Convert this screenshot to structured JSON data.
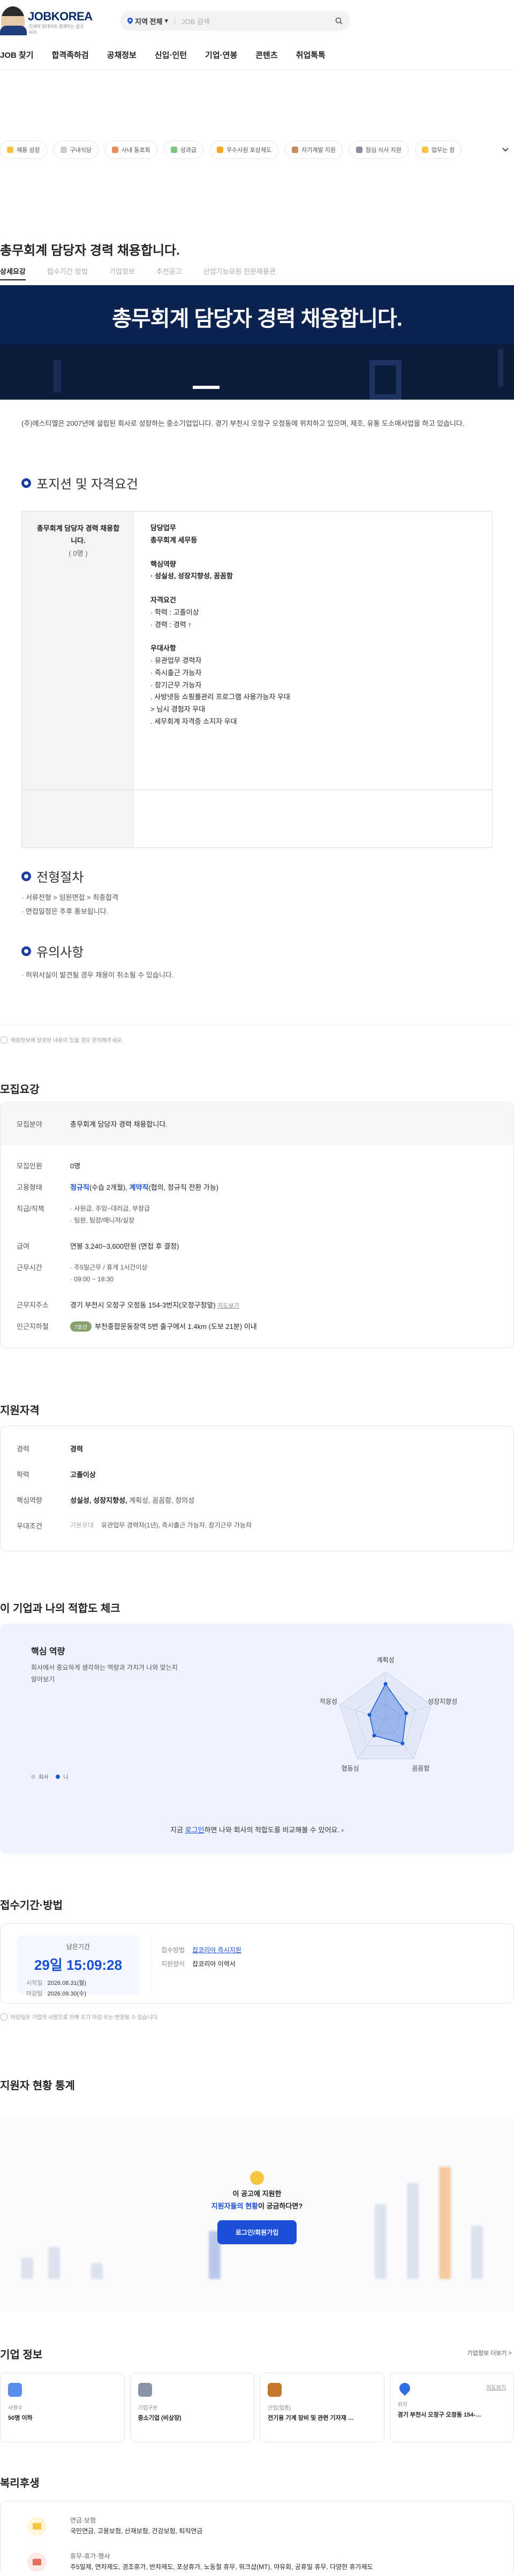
{
  "header": {
    "brand": "JOBKOREA",
    "slogan": "인생의 업데이트 함께하는 잡코리아",
    "region": "지역 전체",
    "search_placeholder": "JOB 검색",
    "nav": [
      "JOB 찾기",
      "합격족하검",
      "공채정보",
      "신입·인턴",
      "기업·연봉",
      "콘텐츠",
      "취업톡톡"
    ]
  },
  "quick_chips": [
    {
      "label": "채용 성장",
      "color": "#f5c542"
    },
    {
      "label": "구내식당",
      "color": "#c9cdd4"
    },
    {
      "label": "사내 동호회",
      "color": "#f08a5d"
    },
    {
      "label": "성과급",
      "color": "#7bc67b"
    },
    {
      "label": "우수사원 포상제도",
      "color": "#f5a623"
    },
    {
      "label": "자기계발 지원",
      "color": "#c98b5a"
    },
    {
      "label": "점심 식사 지원",
      "color": "#8a8f99"
    },
    {
      "label": "업무는 정",
      "color": "#f5c542"
    }
  ],
  "job_title": "총무회계 담당자 경력 채용합니다.",
  "tabs": [
    "상세요강",
    "접수기간·방법",
    "기업정보",
    "추천공고",
    "산업기능요원 전문채용관"
  ],
  "hero_title": "총무회계 담당자 경력 채용합니다.",
  "intro": "(주)에스티엘은 2007년에 설립된 회사로 성장하는 중소기업입니다. 경기 부천시 오정구 오정동에 위치하고 있으며, 제조, 유통 도소매사업을 하고 있습니다.",
  "position_section": {
    "heading": "포지션 및 자격요건",
    "role": "총무회계 담당자 경력 채용합니다.",
    "count": "( 0명 )",
    "duty_title": "담당업무",
    "duty": "총무회계 세무등",
    "core_title": "핵심역량",
    "core": "· 성실성, 성장지향성, 꼼꼼함",
    "qual_title": "자격요건",
    "qual": [
      "· 학력 : 고졸이상",
      "· 경력 : 경력 ↑"
    ],
    "pref_title": "우대사항",
    "pref": [
      "· 유관업무 경력자",
      "· 즉시출근 가능자",
      "· 장기근무 가능자",
      ". 사방넷등 쇼핑몰관리 프로그램 사용가능자 우대",
      "> 님시 경험자 우대",
      ". 세무회계 자격증 소지자 우대"
    ]
  },
  "process": {
    "heading": "전형절차",
    "lines": [
      "· 서류전형 > 임원면접 > 최종합격",
      "· 면접일정은 추후 통보됩니다."
    ]
  },
  "caution": {
    "heading": "유의사항",
    "lines": [
      "· 허위서실이 발견될 경우 채용이 취소될 수 있습니다."
    ]
  },
  "report_note": "채용정보에 잘못된 내용이 있을 경우 문의해주세요.",
  "recruit": {
    "heading": "모집요강",
    "field_k": "모집분야",
    "field_v": "총무회계 담당자 경력 채용합니다.",
    "people_k": "모집인원",
    "people_v": "0명",
    "type_k": "고용형태",
    "type_v1": "정규직",
    "type_v1b": "(수습 2개월),",
    "type_v2": "계약직",
    "type_v2b": "(협의, 정규직 전환 가능)",
    "rank_k": "직급/직책",
    "rank_v": [
      "· 사원급, 주임~대리급, 부장급",
      "· 팀원, 팀장/매니저/실장"
    ],
    "salary_k": "급여",
    "salary_v": "연봉 3,240~3,600만원 (면접 후 결정)",
    "time_k": "근무시간",
    "time_v": [
      "· 주5일근무 / 휴게 1시간이상",
      "· 09:00 ~ 18:30"
    ],
    "addr_k": "근무지주소",
    "addr_v": "경기 부천시 오정구 오정동 154-3번지(오정구청앞)",
    "addr_link": "지도보기",
    "subway_k": "인근지하철",
    "subway_line": "7호선",
    "subway_v": "부천종합운동장역 5번 출구에서 1.4km (도보 21분) 이내"
  },
  "qualify": {
    "heading": "지원자격",
    "career_k": "경력",
    "career_v": "경력",
    "edu_k": "학력",
    "edu_v": "고졸이상",
    "core_k": "핵심역량",
    "core_v1": "성실성, 성장지향성,",
    "core_v2": "계획성, 꼼꼼함, 창의성",
    "pref_k": "우대조건",
    "pref_sub": "기본우대",
    "pref_v": "유관업무 경력자(1년), 즉시출근 가능자, 장기근무 가능자"
  },
  "fit": {
    "heading": "이 기업과 나의 적합도 체크",
    "box_title": "핵심 역량",
    "box_desc": "회사에서 중요하게 생각하는 역량과 가치가 나와 맞는지 알아보기",
    "legend_company": "회사",
    "legend_me": "나",
    "axes": [
      "계획성",
      "성장지향성",
      "꼼꼼함",
      "협동심",
      "적응성"
    ],
    "company_values": [
      0.75,
      0.45,
      0.6,
      0.4,
      0.35
    ],
    "cta_pre": "지금 ",
    "cta_link": "로그인",
    "cta_post": "하면 나와 회사의 적합도를 비교해볼 수 있어요.",
    "company_color": "#9aa5bd",
    "me_color": "#1a5bd6"
  },
  "apply": {
    "heading": "접수기간·방법",
    "remain_label": "남은기간",
    "remain": "29일 15:09:28",
    "start_k": "시작일",
    "start_v": "2026.08.31(월)",
    "end_k": "마감일",
    "end_v": "2026.09.30(수)",
    "method_k": "접수방법",
    "method_v": "잡코리아 즉시지원",
    "form_k": "지원양식",
    "form_v": "잡코리아 이력서",
    "note": "마감일은 기업의 사정으로 인해 조기 마감 또는 변경될 수 있습니다."
  },
  "stats": {
    "heading": "지원자 현황 통계",
    "q1": "이 공고에 지원한",
    "q2a": "지원자들의 현황",
    "q2b": "이 궁금하다면?",
    "btn": "로그인/회원가입"
  },
  "company": {
    "heading": "기업 정보",
    "more": "기업정보 더보기 >",
    "cards": [
      {
        "label": "사원수",
        "value": "50명 이하",
        "color": "#5b8def"
      },
      {
        "label": "기업구분",
        "value": "중소기업 (비상장)",
        "color": "#8a94a6"
      },
      {
        "label": "산업(업종)",
        "value": "전기용 기계 장비 및 관련 기자재 …",
        "color": "#c4772e"
      },
      {
        "label": "위치",
        "value": "경기 부천시 오정구 오정동 154-…",
        "color": "#2f6fe0",
        "link": "지도보기"
      }
    ]
  },
  "welfare": {
    "heading": "복리후생",
    "items": [
      {
        "title": "연금·보험",
        "desc": "국민연금, 고용보험, 산재보험, 건강보험, 퇴직연금",
        "color": "#f5c542"
      },
      {
        "title": "휴무·휴가·행사",
        "desc": "주5일제, 연차제도, 경조휴가, 반차제도, 포상휴가, 노동절 휴무, 워크샵(MT), 야유회, 공휴일 휴무, 다양한 휴가제도",
        "color": "#e36c5d"
      }
    ]
  }
}
